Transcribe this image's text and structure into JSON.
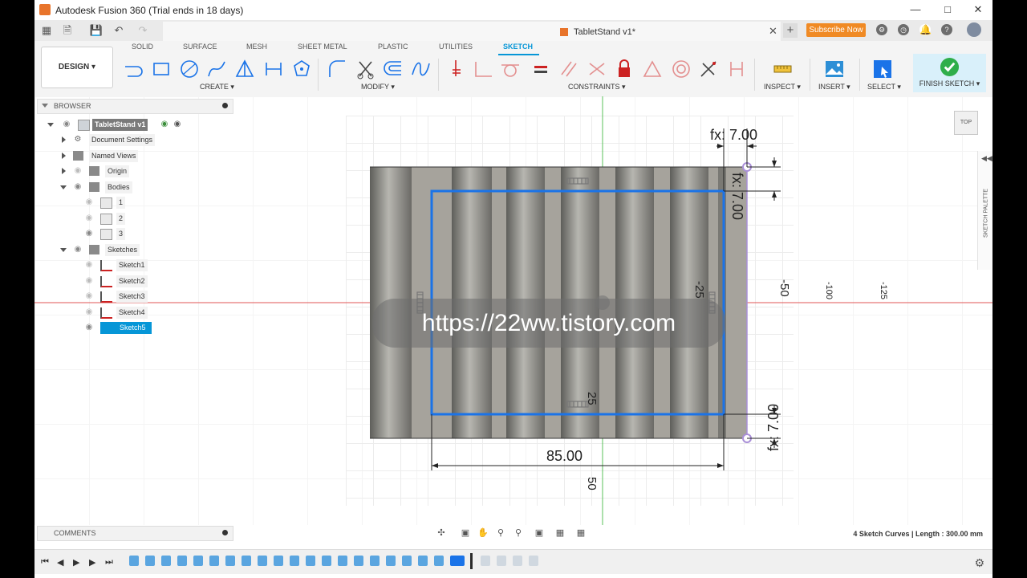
{
  "window": {
    "title": "Autodesk Fusion 360 (Trial ends in 18 days)"
  },
  "document": {
    "tab_title": "TabletStand v1*"
  },
  "header": {
    "subscribe_label": "Subscribe Now"
  },
  "workspace": {
    "label": "DESIGN ▾"
  },
  "workspace_tabs": [
    "SOLID",
    "SURFACE",
    "MESH",
    "SHEET METAL",
    "PLASTIC",
    "UTILITIES",
    "SKETCH"
  ],
  "tool_groups": {
    "create": "CREATE ▾",
    "modify": "MODIFY ▾",
    "constraints": "CONSTRAINTS ▾",
    "inspect": "INSPECT ▾",
    "insert": "INSERT ▾",
    "select": "SELECT ▾",
    "finish": "FINISH SKETCH ▾"
  },
  "browser": {
    "title": "BROWSER",
    "root": "TabletStand v1",
    "items": [
      "Document Settings",
      "Named Views",
      "Origin",
      "Bodies",
      "1",
      "2",
      "3",
      "Sketches",
      "Sketch1",
      "Sketch2",
      "Sketch3",
      "Sketch4",
      "Sketch5"
    ]
  },
  "sketch": {
    "dim_top": "fx: 7.00",
    "dim_right_top": "fx: 7.00",
    "dim_right_bottom": "fx: 7.00",
    "dim_width": "85.00",
    "axis_neg25": "-25",
    "axis_pos25": "25",
    "axis_neg50": "-50",
    "axis_neg100": "-100",
    "axis_neg125": "-125",
    "axis_pos50": "50",
    "axis_100": "100"
  },
  "viewcube": {
    "label": "TOP"
  },
  "palette": {
    "label": "SKETCH PALETTE"
  },
  "comments": {
    "label": "COMMENTS"
  },
  "status": {
    "text": "4 Sketch Curves | Length : 300.00 mm"
  },
  "watermark": {
    "text": "https://22ww.tistory.com"
  },
  "colors": {
    "accent": "#0696d7",
    "sketch_line": "#1a73e8",
    "subscribe": "#f08a24",
    "body": "#a6a39c"
  }
}
